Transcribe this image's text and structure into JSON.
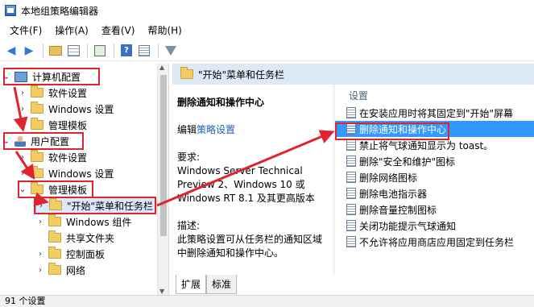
{
  "window": {
    "title": "本地组策略编辑器"
  },
  "menu": [
    "文件(F)",
    "操作(A)",
    "查看(V)",
    "帮助(H)"
  ],
  "toolbar": {
    "icons": [
      "back-arrow-icon",
      "forward-arrow-icon",
      "folder-up-icon",
      "show-hide-tree-icon",
      "export-list-icon",
      "help-icon",
      "properties-icon",
      "filter-icon"
    ]
  },
  "tree": {
    "computer_config": "计算机配置",
    "cc_software": "软件设置",
    "cc_windows": "Windows 设置",
    "cc_admin": "管理模板",
    "user_config": "用户配置",
    "uc_software": "软件设置",
    "uc_windows": "Windows 设置",
    "uc_admin": "管理模板",
    "start_menu": "\"开始\"菜单和任务栏",
    "win_components": "Windows 组件",
    "shared_folders": "共享文件夹",
    "control_panel": "控制面板",
    "network": "网络"
  },
  "middle": {
    "header": "\"开始\"菜单和任务栏",
    "policy_title": "删除通知和操作中心",
    "edit_prefix": "编辑",
    "edit_link": "策略设置",
    "req_label": "要求:",
    "req_line1": "Windows Server Technical",
    "req_line2": "Preview 2、Windows 10 或",
    "req_line3": "Windows RT 8.1 及其更高版本",
    "desc_label": "描述:",
    "desc_line1": "此策略设置可从任务栏的通知区域",
    "desc_line2": "中删除通知和操作中心。"
  },
  "settings": {
    "header": "设置",
    "items": [
      "在安装应用时将其固定到\"开始\"屏幕",
      "删除通知和操作中心",
      "禁止将气球通知显示为 toast。",
      "删除\"安全和维护\"图标",
      "删除网络图标",
      "删除电池指示器",
      "删除音量控制图标",
      "关闭功能提示气球通知",
      "不允许将应用商店应用固定到任务栏"
    ]
  },
  "tabs": [
    "扩展",
    "标准"
  ],
  "status": "91 个设置",
  "colors": {
    "highlight": "#3399ff",
    "annotation_red": "#e0242d"
  }
}
